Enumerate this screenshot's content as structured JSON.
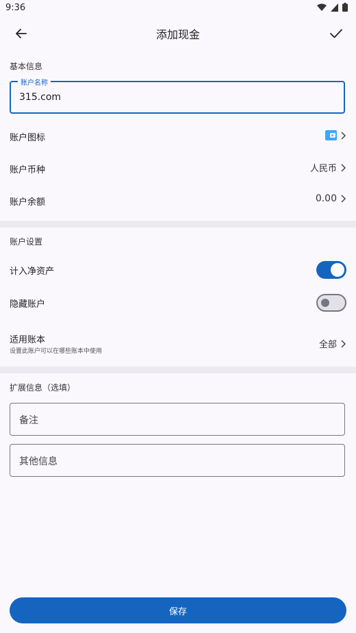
{
  "status_bar": {
    "time": "9:36"
  },
  "app_bar": {
    "title": "添加现金"
  },
  "basic_info": {
    "section_label": "基本信息",
    "account_name": {
      "label": "账户名称",
      "value": "315.com"
    },
    "rows": {
      "icon": {
        "label": "账户图标"
      },
      "currency": {
        "label": "账户币种",
        "value": "人民币"
      },
      "balance": {
        "label": "账户余额",
        "value": "0.00"
      }
    }
  },
  "account_settings": {
    "section_label": "账户设置",
    "net_assets": {
      "label": "计入净资产",
      "enabled": true
    },
    "hide_account": {
      "label": "隐藏账户",
      "enabled": false
    },
    "applicable_books": {
      "label": "适用账本",
      "subtitle": "设置此账户可以在哪些账本中使用",
      "value": "全部"
    }
  },
  "extended_info": {
    "section_label": "扩展信息（选填）",
    "note_placeholder": "备注",
    "other_placeholder": "其他信息"
  },
  "footer": {
    "save_label": "保存"
  },
  "colors": {
    "accent": "#1565c0",
    "background": "#fbf8fd"
  }
}
